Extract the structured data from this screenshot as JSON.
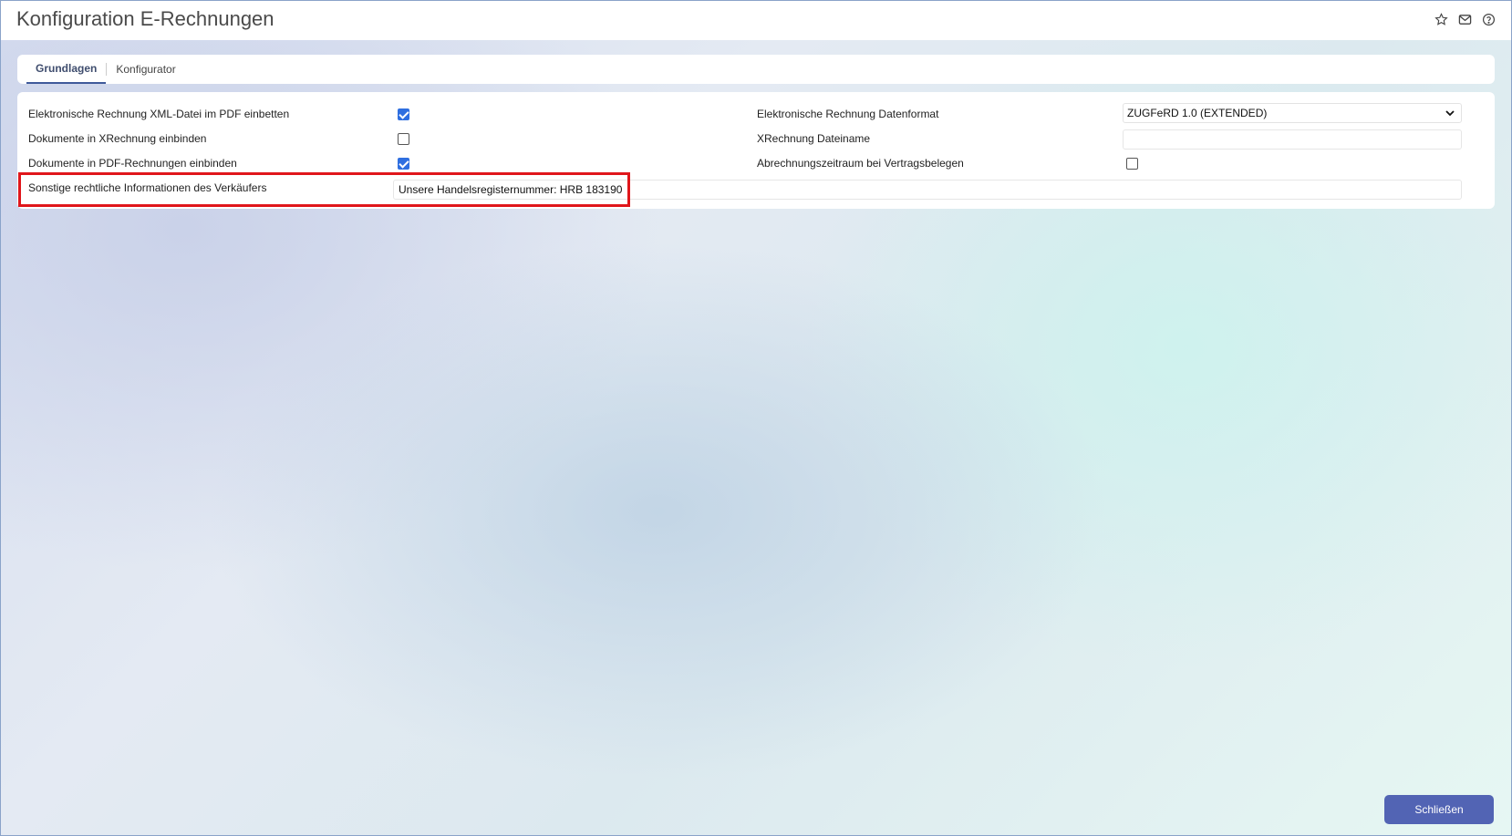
{
  "header": {
    "title": "Konfiguration E-Rechnungen",
    "icons": [
      "star-icon",
      "mail-icon",
      "help-icon"
    ]
  },
  "tabs": [
    {
      "label": "Grundlagen",
      "active": true
    },
    {
      "label": "Konfigurator",
      "active": false
    }
  ],
  "left_fields": [
    {
      "label": "Elektronische Rechnung XML-Datei im PDF einbetten",
      "checked": true
    },
    {
      "label": "Dokumente in XRechnung einbinden",
      "checked": false
    },
    {
      "label": "Dokumente in PDF-Rechnungen einbinden",
      "checked": true
    }
  ],
  "right_fields": {
    "datenformat_label": "Elektronische Rechnung Datenformat",
    "datenformat_value": "ZUGFeRD 1.0 (EXTENDED)",
    "dateiname_label": "XRechnung Dateiname",
    "dateiname_value": "",
    "abrechnung_label": "Abrechnungszeitraum bei Vertragsbelegen",
    "abrechnung_checked": false
  },
  "legal_info": {
    "label": "Sonstige rechtliche Informationen des Verkäufers",
    "value": "Unsere Handelsregisternummer: HRB 183190"
  },
  "footer": {
    "close_label": "Schließen"
  },
  "colors": {
    "accent": "#5264b4",
    "checkbox": "#2f6fe0",
    "highlight": "#e0161b"
  }
}
